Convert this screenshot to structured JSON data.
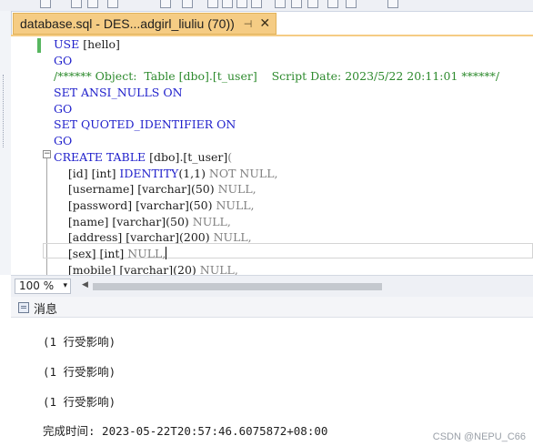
{
  "tab": {
    "title": "database.sql - DES...adgirl_liuliu (70))",
    "pin_icon": "⊣",
    "close_icon": "✕"
  },
  "code_lines": [
    [
      {
        "t": "USE ",
        "c": "kw"
      },
      {
        "t": "[hello]",
        "c": "bk"
      }
    ],
    [
      {
        "t": "GO",
        "c": "kw"
      }
    ],
    [
      {
        "t": "/****** Object:  Table [dbo].[t_user]    Script Date: 2023/5/22 20:11:01 ******/",
        "c": "cm"
      }
    ],
    [
      {
        "t": "SET ANSI_NULLS ON",
        "c": "kw"
      }
    ],
    [
      {
        "t": "GO",
        "c": "kw"
      }
    ],
    [
      {
        "t": "SET QUOTED_IDENTIFIER ON",
        "c": "kw"
      }
    ],
    [
      {
        "t": "GO",
        "c": "kw"
      }
    ],
    [
      {
        "t": "CREATE TABLE ",
        "c": "kw"
      },
      {
        "t": "[dbo].[t_user]",
        "c": "bk"
      },
      {
        "t": "(",
        "c": "gr"
      }
    ],
    [
      {
        "t": "    [id] [int] ",
        "c": "bk"
      },
      {
        "t": "IDENTITY",
        "c": "kw"
      },
      {
        "t": "(1,1) ",
        "c": "bk"
      },
      {
        "t": "NOT NULL,",
        "c": "gr"
      }
    ],
    [
      {
        "t": "    [username] [varchar]",
        "c": "bk"
      },
      {
        "t": "(50) ",
        "c": "bk"
      },
      {
        "t": "NULL,",
        "c": "gr"
      }
    ],
    [
      {
        "t": "    [password] [varchar]",
        "c": "bk"
      },
      {
        "t": "(50) ",
        "c": "bk"
      },
      {
        "t": "NULL,",
        "c": "gr"
      }
    ],
    [
      {
        "t": "    [name] [varchar]",
        "c": "bk"
      },
      {
        "t": "(50) ",
        "c": "bk"
      },
      {
        "t": "NULL,",
        "c": "gr"
      }
    ],
    [
      {
        "t": "    [address] [varchar]",
        "c": "bk"
      },
      {
        "t": "(200) ",
        "c": "bk"
      },
      {
        "t": "NULL,",
        "c": "gr"
      }
    ],
    [
      {
        "t": "    [sex] [int] ",
        "c": "bk"
      },
      {
        "t": "NULL,",
        "c": "gr"
      }
    ],
    [
      {
        "t": "    [mobile] [varchar]",
        "c": "bk"
      },
      {
        "t": "(20) ",
        "c": "bk"
      },
      {
        "t": "NULL,",
        "c": "gr"
      }
    ]
  ],
  "zoom": {
    "value": "100 %",
    "dropdown_icon": "▾",
    "scroll_left_icon": "◀"
  },
  "messages_tab": {
    "label": "消息",
    "icon": "messages-icon"
  },
  "messages": [
    "(1 行受影响)",
    "(1 行受影响)",
    "(1 行受影响)",
    "完成时间: 2023-05-22T20:57:46.6075872+08:00"
  ],
  "watermark": "CSDN @NEPU_C66",
  "colors": {
    "keyword": "#1e1ecb",
    "comment": "#2d8a2d",
    "gray": "#808080",
    "tab_active": "#f5cc84"
  }
}
